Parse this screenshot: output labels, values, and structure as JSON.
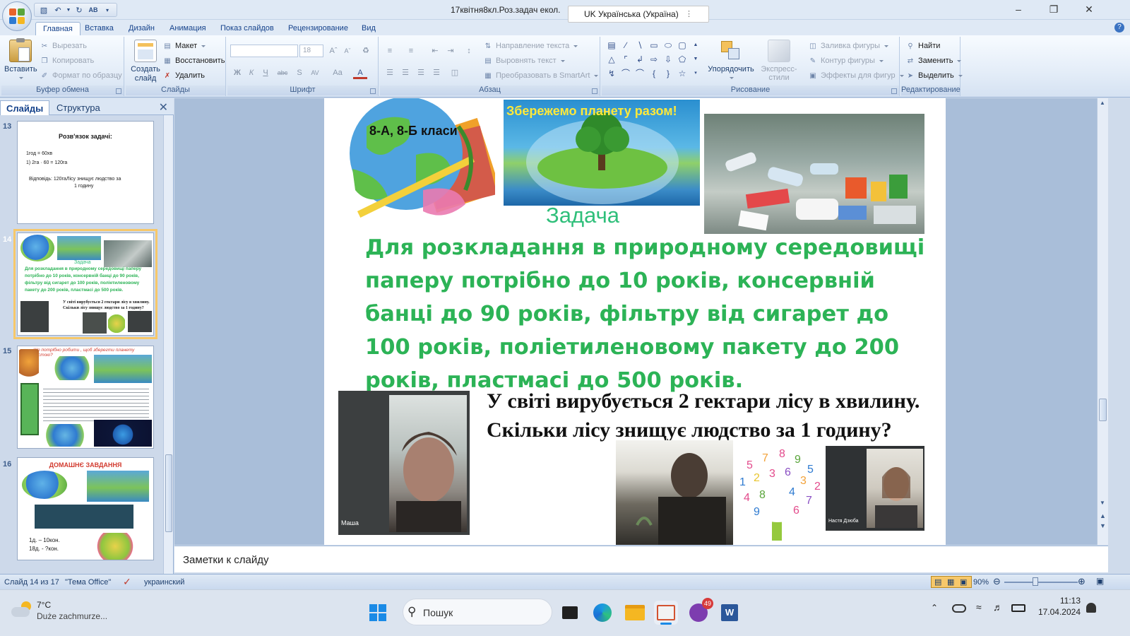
{
  "window": {
    "title": "17квітня8кл.Роз.задач екол.",
    "language_pill": "UK Українська (Україна)"
  },
  "ribbon": {
    "tabs": [
      "Главная",
      "Вставка",
      "Дизайн",
      "Анимация",
      "Показ слайдов",
      "Рецензирование",
      "Вид"
    ],
    "active_tab": "Главная",
    "clipboard": {
      "paste": "Вставить",
      "cut": "Вырезать",
      "copy": "Копировать",
      "format_painter": "Формат по образцу",
      "label": "Буфер обмена"
    },
    "slides": {
      "new_slide": "Создать слайд",
      "layout": "Макет",
      "reset": "Восстановить",
      "delete": "Удалить",
      "label": "Слайды"
    },
    "font": {
      "size": "18",
      "label": "Шрифт"
    },
    "paragraph": {
      "text_direction": "Направление текста",
      "align_text": "Выровнять текст",
      "smartart": "Преобразовать в SmartArt",
      "label": "Абзац"
    },
    "drawing": {
      "arrange": "Упорядочить",
      "quick_styles": "Экспресс-стили",
      "shape_fill": "Заливка фигуры",
      "shape_outline": "Контур фигуры",
      "shape_effects": "Эффекты для фигур",
      "label": "Рисование"
    },
    "editing": {
      "find": "Найти",
      "replace": "Заменить",
      "select": "Выделить",
      "label": "Редактирование"
    }
  },
  "left_panel": {
    "tabs": [
      "Слайды",
      "Структура"
    ],
    "slides": [
      {
        "number": "13",
        "title": "Розв'язок задачі:",
        "line1": "1год = 60хв",
        "line2": "1) 2га · 60 = 120га",
        "line3": "Відповідь: 120гаЛісу знищує людство за",
        "line4": "1 годину"
      },
      {
        "number": "14",
        "title": "Задача",
        "text": "Для розкладання в природному середовищі паперу потрібно до 10 років, консервній банці до 90 років, фільтру від сигарет до 100 років, поліетиленовому пакету до 200 років, пластмасі до 500 років.",
        "question": "У світі вирубується 2 гектари лісу в хвилину. Скільки лісу знищує людство за 1 годину?"
      },
      {
        "number": "15",
        "title": "Що потрібно робити , щоб зберегти планету чистою?"
      },
      {
        "number": "16",
        "title": "ДОМАШНЄ ЗАВДАННЯ",
        "line1": "1д. – 10кон.",
        "line2": "18д. - ?кон."
      }
    ]
  },
  "slide": {
    "classes_label": "8-А, 8-Б класи",
    "banner": "Збережемо планету разом!",
    "title": "Задача",
    "problem": "Для розкладання в природному середовищі паперу потрібно до 10 років, консервній банці до 90 років, фільтру від сигарет до 100 років, поліетиленовому пакету до 200 років, пластмасі до 500 років.",
    "question": "У світі вирубується 2 гектари лісу в хвилину.  Скільки лісу знищує людство за 1 годину?",
    "video1_name": "Маша",
    "video3_name": "Настя Дзюба"
  },
  "notes_placeholder": "Заметки к слайду",
  "status": {
    "slide_of": "Слайд 14 из 17",
    "theme": "\"Тема Office\"",
    "language": "украинский",
    "zoom": "90%"
  },
  "taskbar": {
    "weather_temp": "7°C",
    "weather_desc": "Duże zachmurze...",
    "search": "Пошук",
    "badge_count": "49",
    "time": "11:13",
    "date": "17.04.2024"
  },
  "colors": {
    "problem_green": "#2cb356",
    "title_green": "#2fbf7a",
    "ribbon_blue": "#15428b",
    "selected_thumb": "#f7c86a"
  }
}
